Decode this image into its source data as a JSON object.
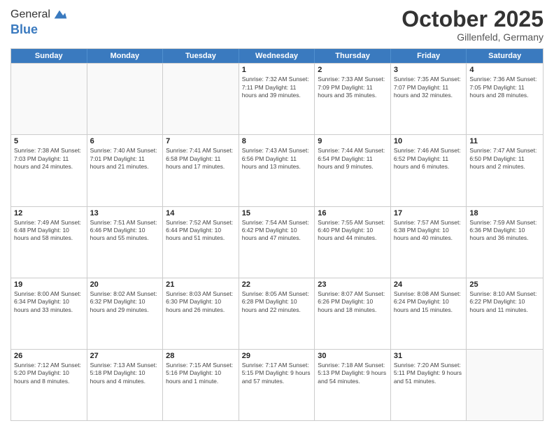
{
  "header": {
    "logo_general": "General",
    "logo_blue": "Blue",
    "month": "October 2025",
    "location": "Gillenfeld, Germany"
  },
  "weekdays": [
    "Sunday",
    "Monday",
    "Tuesday",
    "Wednesday",
    "Thursday",
    "Friday",
    "Saturday"
  ],
  "rows": [
    [
      {
        "num": "",
        "info": "",
        "empty": true
      },
      {
        "num": "",
        "info": "",
        "empty": true
      },
      {
        "num": "",
        "info": "",
        "empty": true
      },
      {
        "num": "1",
        "info": "Sunrise: 7:32 AM\nSunset: 7:11 PM\nDaylight: 11 hours\nand 39 minutes."
      },
      {
        "num": "2",
        "info": "Sunrise: 7:33 AM\nSunset: 7:09 PM\nDaylight: 11 hours\nand 35 minutes."
      },
      {
        "num": "3",
        "info": "Sunrise: 7:35 AM\nSunset: 7:07 PM\nDaylight: 11 hours\nand 32 minutes."
      },
      {
        "num": "4",
        "info": "Sunrise: 7:36 AM\nSunset: 7:05 PM\nDaylight: 11 hours\nand 28 minutes."
      }
    ],
    [
      {
        "num": "5",
        "info": "Sunrise: 7:38 AM\nSunset: 7:03 PM\nDaylight: 11 hours\nand 24 minutes."
      },
      {
        "num": "6",
        "info": "Sunrise: 7:40 AM\nSunset: 7:01 PM\nDaylight: 11 hours\nand 21 minutes."
      },
      {
        "num": "7",
        "info": "Sunrise: 7:41 AM\nSunset: 6:58 PM\nDaylight: 11 hours\nand 17 minutes."
      },
      {
        "num": "8",
        "info": "Sunrise: 7:43 AM\nSunset: 6:56 PM\nDaylight: 11 hours\nand 13 minutes."
      },
      {
        "num": "9",
        "info": "Sunrise: 7:44 AM\nSunset: 6:54 PM\nDaylight: 11 hours\nand 9 minutes."
      },
      {
        "num": "10",
        "info": "Sunrise: 7:46 AM\nSunset: 6:52 PM\nDaylight: 11 hours\nand 6 minutes."
      },
      {
        "num": "11",
        "info": "Sunrise: 7:47 AM\nSunset: 6:50 PM\nDaylight: 11 hours\nand 2 minutes."
      }
    ],
    [
      {
        "num": "12",
        "info": "Sunrise: 7:49 AM\nSunset: 6:48 PM\nDaylight: 10 hours\nand 58 minutes."
      },
      {
        "num": "13",
        "info": "Sunrise: 7:51 AM\nSunset: 6:46 PM\nDaylight: 10 hours\nand 55 minutes."
      },
      {
        "num": "14",
        "info": "Sunrise: 7:52 AM\nSunset: 6:44 PM\nDaylight: 10 hours\nand 51 minutes."
      },
      {
        "num": "15",
        "info": "Sunrise: 7:54 AM\nSunset: 6:42 PM\nDaylight: 10 hours\nand 47 minutes."
      },
      {
        "num": "16",
        "info": "Sunrise: 7:55 AM\nSunset: 6:40 PM\nDaylight: 10 hours\nand 44 minutes."
      },
      {
        "num": "17",
        "info": "Sunrise: 7:57 AM\nSunset: 6:38 PM\nDaylight: 10 hours\nand 40 minutes."
      },
      {
        "num": "18",
        "info": "Sunrise: 7:59 AM\nSunset: 6:36 PM\nDaylight: 10 hours\nand 36 minutes."
      }
    ],
    [
      {
        "num": "19",
        "info": "Sunrise: 8:00 AM\nSunset: 6:34 PM\nDaylight: 10 hours\nand 33 minutes."
      },
      {
        "num": "20",
        "info": "Sunrise: 8:02 AM\nSunset: 6:32 PM\nDaylight: 10 hours\nand 29 minutes."
      },
      {
        "num": "21",
        "info": "Sunrise: 8:03 AM\nSunset: 6:30 PM\nDaylight: 10 hours\nand 26 minutes."
      },
      {
        "num": "22",
        "info": "Sunrise: 8:05 AM\nSunset: 6:28 PM\nDaylight: 10 hours\nand 22 minutes."
      },
      {
        "num": "23",
        "info": "Sunrise: 8:07 AM\nSunset: 6:26 PM\nDaylight: 10 hours\nand 18 minutes."
      },
      {
        "num": "24",
        "info": "Sunrise: 8:08 AM\nSunset: 6:24 PM\nDaylight: 10 hours\nand 15 minutes."
      },
      {
        "num": "25",
        "info": "Sunrise: 8:10 AM\nSunset: 6:22 PM\nDaylight: 10 hours\nand 11 minutes."
      }
    ],
    [
      {
        "num": "26",
        "info": "Sunrise: 7:12 AM\nSunset: 5:20 PM\nDaylight: 10 hours\nand 8 minutes."
      },
      {
        "num": "27",
        "info": "Sunrise: 7:13 AM\nSunset: 5:18 PM\nDaylight: 10 hours\nand 4 minutes."
      },
      {
        "num": "28",
        "info": "Sunrise: 7:15 AM\nSunset: 5:16 PM\nDaylight: 10 hours\nand 1 minute."
      },
      {
        "num": "29",
        "info": "Sunrise: 7:17 AM\nSunset: 5:15 PM\nDaylight: 9 hours\nand 57 minutes."
      },
      {
        "num": "30",
        "info": "Sunrise: 7:18 AM\nSunset: 5:13 PM\nDaylight: 9 hours\nand 54 minutes."
      },
      {
        "num": "31",
        "info": "Sunrise: 7:20 AM\nSunset: 5:11 PM\nDaylight: 9 hours\nand 51 minutes."
      },
      {
        "num": "",
        "info": "",
        "empty": true
      }
    ]
  ]
}
